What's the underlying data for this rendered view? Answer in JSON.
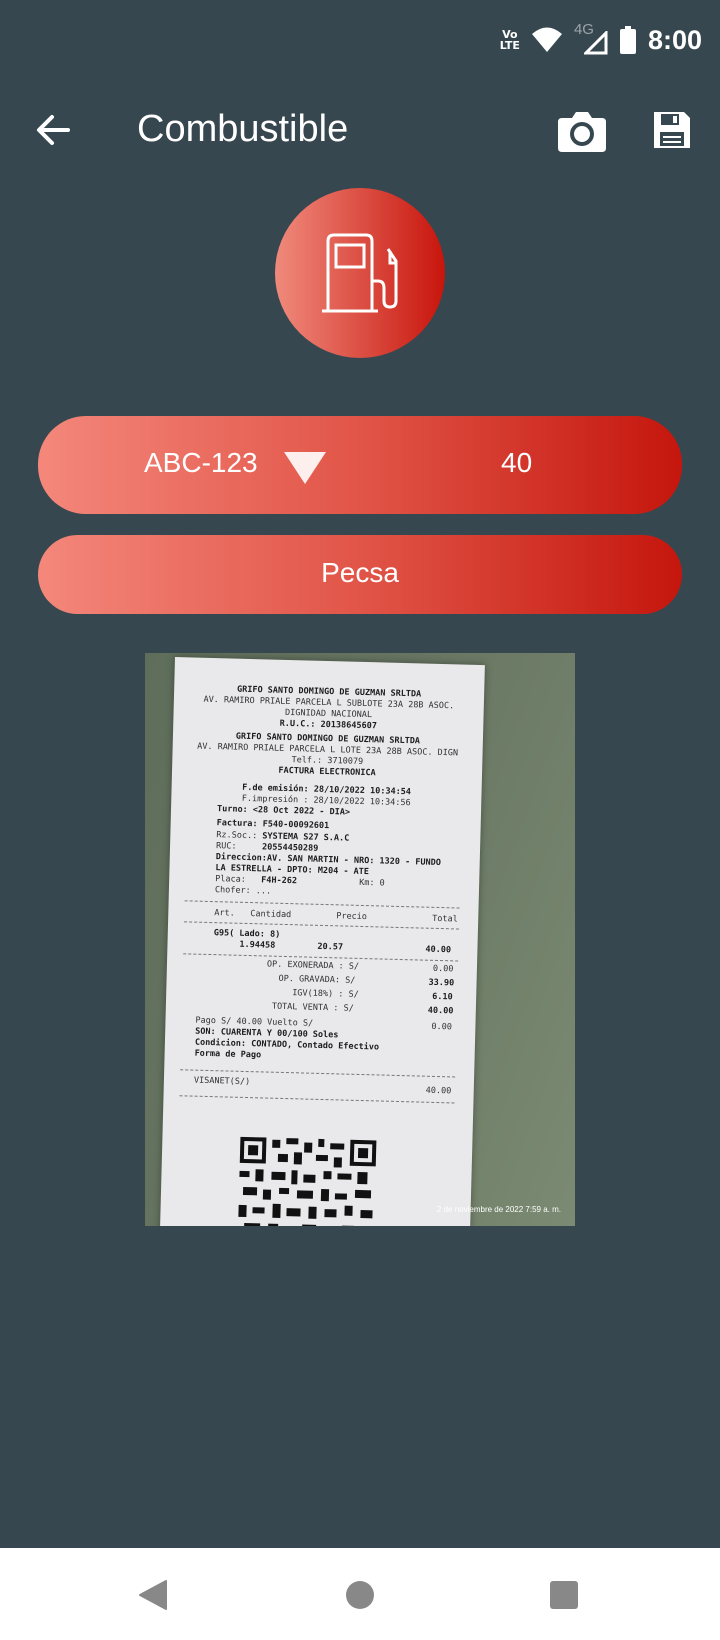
{
  "status_bar": {
    "time": "8:00",
    "network": "4G",
    "volte_line1": "Vo",
    "volte_line2": "LTE"
  },
  "app_bar": {
    "title": "Combustible"
  },
  "vehicle": {
    "plate": "ABC-123",
    "amount": "40"
  },
  "provider": {
    "name": "Pecsa"
  },
  "receipt": {
    "company": "GRIFO SANTO DOMINGO DE GUZMAN SRLTDA",
    "address1": "AV. RAMIRO PRIALE PARCELA L SUBLOTE 23A 28B ASOC.",
    "address2": "DIGNIDAD NACIONAL",
    "ruc": "R.U.C.: 20138645607",
    "company2": "GRIFO SANTO DOMINGO DE GUZMAN SRLTDA",
    "address3": "AV. RAMIRO PRIALE PARCELA L LOTE 23A 28B ASOC. DIGN",
    "phone": "Telf.: 3710079",
    "doc_type": "FACTURA ELECTRONICA",
    "emission": "F.de emisión: 28/10/2022 10:34:54",
    "printed": "F.impresión : 28/10/2022 10:34:56",
    "shift": "Turno: <28 Oct 2022 - DIA>",
    "invoice": "Factura: F540-00092601",
    "client_label": "Rz.Soc.:",
    "client": "SYSTEMA S27 S.A.C",
    "ruc2_label": "RUC:",
    "ruc2": "20554450289",
    "direction1": "Direccion:AV. SAN MARTIN - NRO: 1320 - FUNDO",
    "direction2": "LA ESTRELLA - DPTO: M204 - ATE",
    "plate_label": "Placa:",
    "plate": "F4H-262",
    "km": "Km:  0",
    "driver": "Chofer:    ...",
    "col_art": "Art.",
    "col_qty": "Cantidad",
    "col_price": "Precio",
    "col_total": "Total",
    "item": "G95( Lado: 8)",
    "item_qty": "1.94458",
    "item_price": "20.57",
    "item_total": "40.00",
    "exonerada_label": "OP. EXONERADA : S/",
    "exonerada": "0.00",
    "gravada_label": "OP. GRAVADA: S/",
    "gravada": "33.90",
    "igv_label": "IGV(18%) : S/",
    "igv": "6.10",
    "total_label": "TOTAL VENTA : S/",
    "total": "40.00",
    "pago": "Pago S/          40.00  Vuelto S/",
    "vuelto": "0.00",
    "son": "SON: CUARENTA Y 00/100 Soles",
    "condicion": "Condicion: CONTADO, Contado Efectivo",
    "forma": "Forma de Pago",
    "visanet_label": "VISANET(S/)",
    "visanet": "40.00",
    "photo_stamp": "2 de noviembre de 2022 7:59 a. m."
  }
}
